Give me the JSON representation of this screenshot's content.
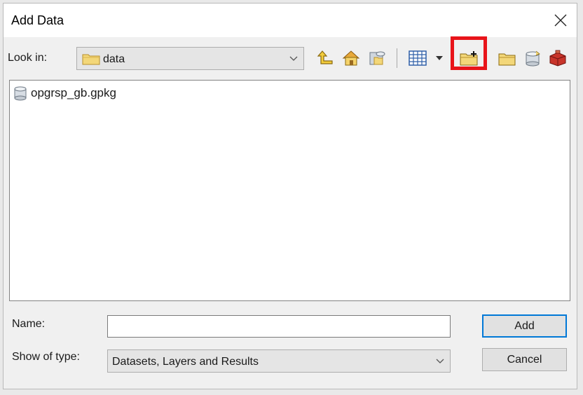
{
  "dialog": {
    "title": "Add Data",
    "close_icon": "close-icon"
  },
  "toolbar": {
    "look_in_label": "Look in:",
    "look_in_value": "data",
    "icons": [
      "up-one-level-icon",
      "home-icon",
      "connect-folder-icon",
      "view-options-icon",
      "new-folder-icon",
      "folder-icon",
      "database-icon",
      "toolbox-icon"
    ]
  },
  "files": [
    {
      "name": "opgrsp_gb.gpkg",
      "icon": "geopackage-icon"
    }
  ],
  "form": {
    "name_label": "Name:",
    "name_value": "",
    "type_label": "Show of type:",
    "type_value": "Datasets, Layers and Results"
  },
  "buttons": {
    "add": "Add",
    "cancel": "Cancel"
  },
  "colors": {
    "highlight": "#e8141a",
    "default_button_border": "#0078d7"
  }
}
